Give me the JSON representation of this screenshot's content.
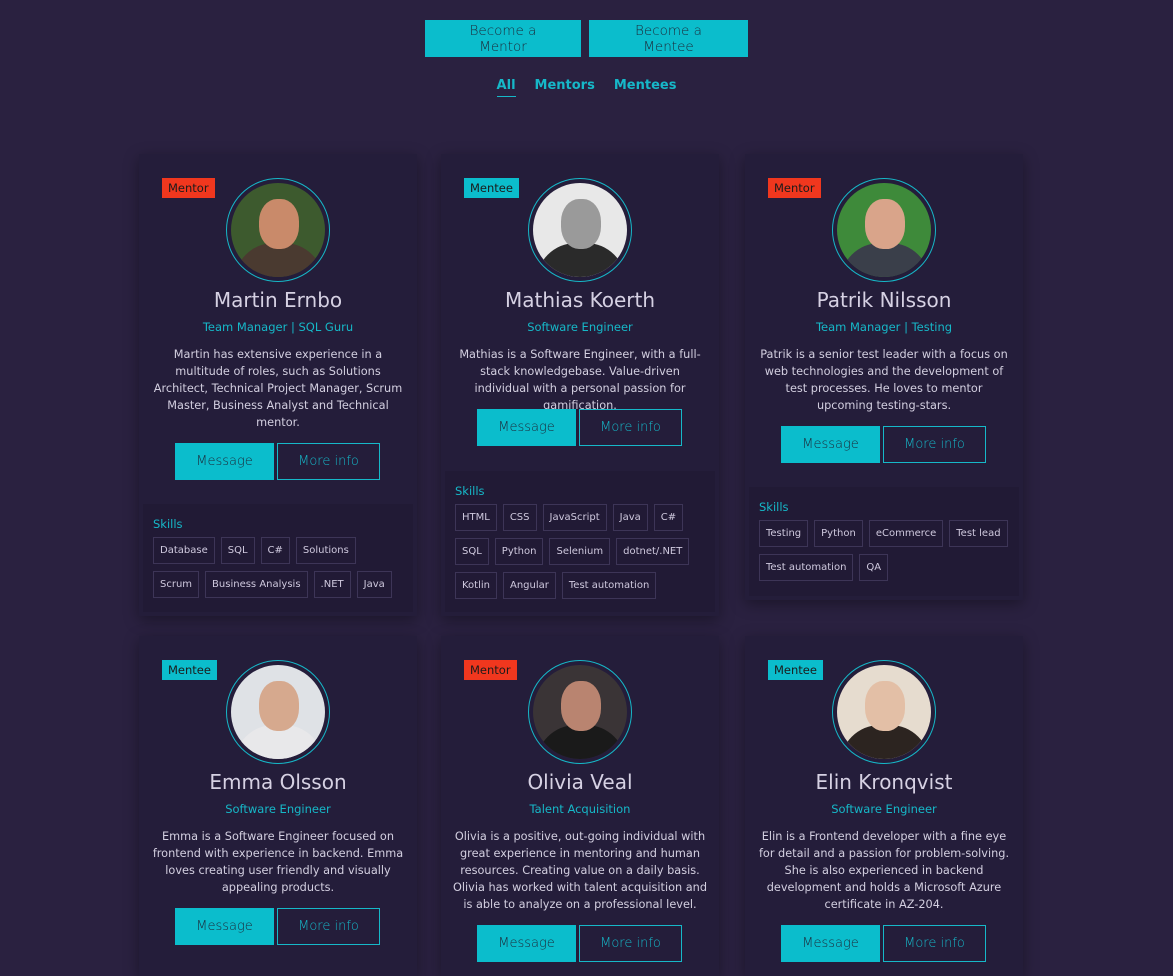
{
  "top": {
    "become_mentor": "Become a Mentor",
    "become_mentee": "Become a Mentee"
  },
  "filters": [
    "All",
    "Mentors",
    "Mentees"
  ],
  "skills_title": "Skills",
  "message_label": "Message",
  "more_label": "More info",
  "colors": {
    "background": "#2a2140",
    "accent": "#0bbdcc",
    "mentor_badge": "#f0371e",
    "card": "#241d3a"
  },
  "cards": [
    {
      "badge": "Mentor",
      "name": "Martin Ernbo",
      "role": "Team Manager | SQL Guru",
      "bio": "Martin has extensive experience in a multitude of roles, such as Solutions Architect, Technical Project Manager, Scrum Master, Business Analyst and Technical mentor.",
      "skills": [
        "Database",
        "SQL",
        "C#",
        "Solutions",
        "Scrum",
        "Business Analysis",
        ".NET",
        "Java"
      ]
    },
    {
      "badge": "Mentee",
      "name": "Mathias Koerth",
      "role": "Software Engineer",
      "bio": "Mathias is a Software Engineer, with a full-stack knowledgebase. Value-driven individual with a personal passion for gamification.",
      "skills": [
        "HTML",
        "CSS",
        "JavaScript",
        "Java",
        "C#",
        "SQL",
        "Python",
        "Selenium",
        "dotnet/.NET",
        "Kotlin",
        "Angular",
        "Test automation"
      ]
    },
    {
      "badge": "Mentor",
      "name": "Patrik Nilsson",
      "role": "Team Manager | Testing",
      "bio": "Patrik is a senior test leader with a focus on web technologies and the development of test processes. He loves to mentor upcoming testing-stars.",
      "skills": [
        "Testing",
        "Python",
        "eCommerce",
        "Test lead",
        "Test automation",
        "QA"
      ]
    },
    {
      "badge": "Mentee",
      "name": "Emma Olsson",
      "role": "Software Engineer",
      "bio": "Emma is a Software Engineer focused on frontend with experience in backend. Emma loves creating user friendly and visually appealing products.",
      "skills": []
    },
    {
      "badge": "Mentor",
      "name": "Olivia Veal",
      "role": "Talent Acquisition",
      "bio": "Olivia is a positive, out-going individual with great experience in mentoring and human resources. Creating value on a daily basis. Olivia has worked with talent acquisition and is able to analyze on a professional level.",
      "skills": []
    },
    {
      "badge": "Mentee",
      "name": "Elin Kronqvist",
      "role": "Software Engineer",
      "bio": "Elin is a Frontend developer with a fine eye for detail and a passion for problem-solving. She is also experienced in backend development and holds a Microsoft Azure certificate in AZ-204.",
      "skills": []
    }
  ]
}
